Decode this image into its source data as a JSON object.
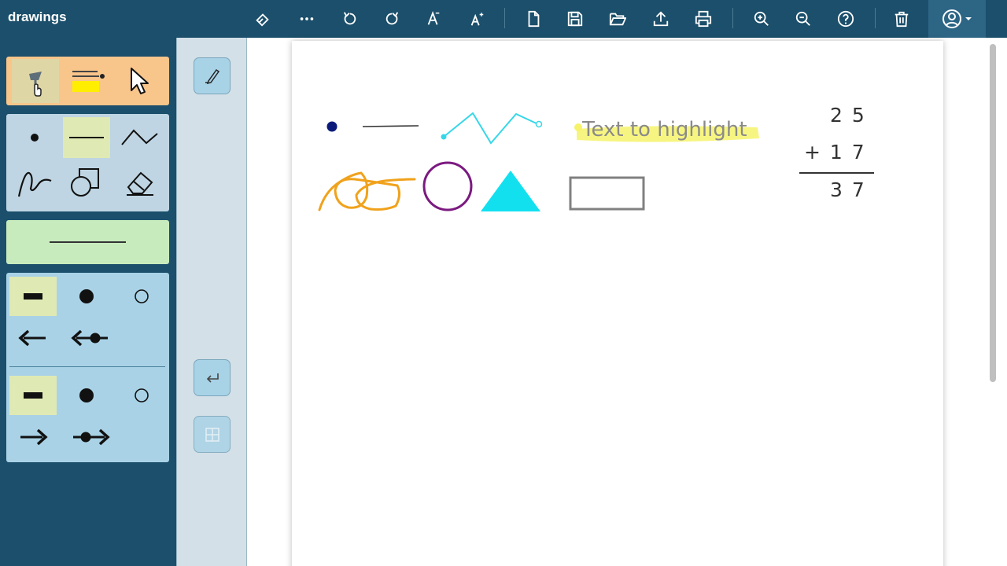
{
  "app": {
    "title": "drawings"
  },
  "toolbar": {
    "buttons": [
      "eraser-icon",
      "more-icon",
      "undo-icon",
      "redo-icon",
      "font-decrease-icon",
      "font-increase-icon",
      "new-file-icon",
      "save-icon",
      "open-folder-icon",
      "upload-icon",
      "print-icon",
      "zoom-in-icon",
      "zoom-out-icon",
      "help-icon",
      "trash-icon",
      "user-icon"
    ]
  },
  "left_panel": {
    "tools": [
      "pen-tool",
      "highlighter-tool",
      "select-tool"
    ],
    "selected_tool": "pen-tool",
    "shapes": [
      "dot",
      "line",
      "polyline",
      "freehand",
      "shape",
      "eraser"
    ],
    "selected_shape": "line",
    "line_start_styles": [
      "flat",
      "round",
      "open-circle",
      "arrow",
      "arrow-dot"
    ],
    "line_end_styles": [
      "flat",
      "round",
      "open-circle",
      "arrow",
      "dot-arrow"
    ]
  },
  "canvas": {
    "highlight_text": "Text to highlight",
    "math": {
      "row1": "2 5",
      "row2": "+ 1 7",
      "result": "3 7"
    },
    "colors": {
      "dot": "#0b1a7a",
      "polyline": "#36d7e7",
      "highlight": "#f6f36b",
      "freehand": "#f0a21c",
      "circle": "#7b1a80",
      "triangle": "#12e0ef",
      "rect": "#808080"
    }
  }
}
